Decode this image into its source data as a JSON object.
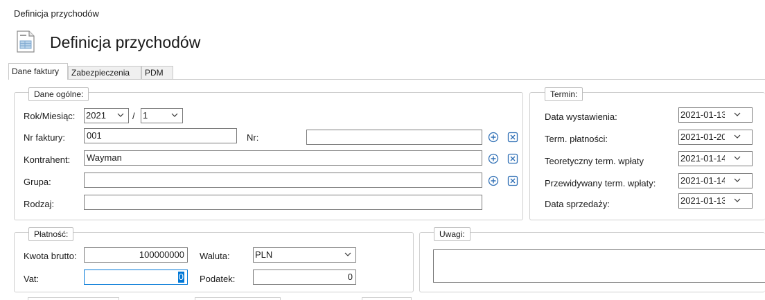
{
  "window": {
    "title": "Definicja przychodów"
  },
  "header": {
    "title": "Definicja przychodów",
    "icon": "document-form-icon"
  },
  "tabs": [
    {
      "label": "Dane faktury",
      "active": true
    },
    {
      "label": "Zabezpieczenia",
      "active": false
    },
    {
      "label": "PDM",
      "active": false
    }
  ],
  "general": {
    "legend": "Dane ogólne:",
    "year_month_label": "Rok/Miesiąc:",
    "year": "2021",
    "separator": "/",
    "month": "1",
    "invoice_no_label": "Nr faktury:",
    "invoice_no": "001",
    "nr_label": "Nr:",
    "nr_value": "",
    "contractor_label": "Kontrahent:",
    "contractor": "Wayman",
    "group_label": "Grupa:",
    "group_value": "",
    "kind_label": "Rodzaj:",
    "kind_value": ""
  },
  "terms": {
    "legend": "Termin:",
    "rows": [
      {
        "label": "Data wystawienia:",
        "value": "2021-01-13"
      },
      {
        "label": "Term. płatności:",
        "value": "2021-01-20"
      },
      {
        "label": "Teoretyczny term. wpłaty",
        "value": "2021-01-14"
      },
      {
        "label": "Przewidywany term. wpłaty:",
        "value": "2021-01-14"
      },
      {
        "label": "Data sprzedaży:",
        "value": "2021-01-13"
      }
    ]
  },
  "payment": {
    "legend": "Płatność:",
    "gross_label": "Kwota brutto:",
    "gross_value": "100000000",
    "currency_label": "Waluta:",
    "currency": "PLN",
    "vat_label": "Vat:",
    "vat_value": "0",
    "tax_label": "Podatek:",
    "tax_value": "0"
  },
  "notes": {
    "legend": "Uwagi:",
    "value": ""
  },
  "colors": {
    "accent": "#0078d7",
    "border": "#7a7a7a",
    "group_border": "#cfcfcf"
  }
}
